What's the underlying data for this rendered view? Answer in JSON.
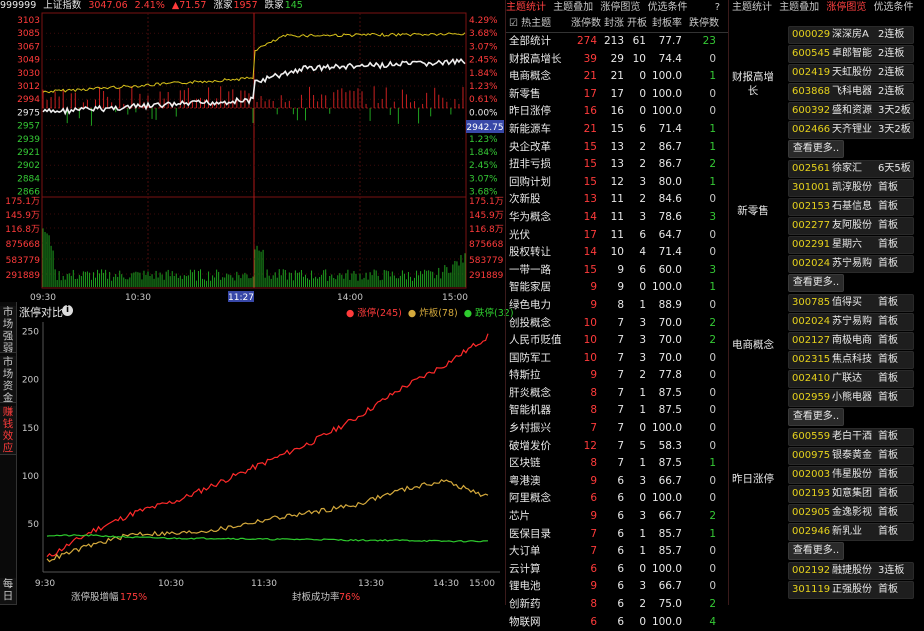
{
  "index_header": {
    "code": "999999",
    "name": "上证指数",
    "price": "3047.06",
    "pct": "2.41%",
    "change": "▲71.57",
    "up_label": "涨家",
    "up_count": "1957",
    "down_label": "跌家",
    "down_count": "145"
  },
  "main_chart": {
    "left_price_ticks": [
      "3103",
      "3085",
      "3067",
      "3049",
      "3030",
      "3012",
      "2994",
      "2975",
      "2957",
      "2939",
      "2921",
      "2902",
      "2884",
      "2866"
    ],
    "right_pct_ticks": [
      "4.29%",
      "3.68%",
      "3.07%",
      "2.45%",
      "1.84%",
      "1.23%",
      "0.61%",
      "0.00%",
      "0.61%",
      "1.23%",
      "1.84%",
      "2.45%",
      "3.07%",
      "3.68%"
    ],
    "left_vol_ticks": [
      "175.1万",
      "145.9万",
      "116.8万",
      "875668",
      "583779",
      "291889"
    ],
    "right_vol_ticks": [
      "175.1万",
      "145.9万",
      "116.8万",
      "875668",
      "583779",
      "291889"
    ],
    "time_ticks": [
      "09:30",
      "10:30",
      "14:00",
      "15:00"
    ],
    "cursor_time": "11:27",
    "cursor_price": "2942.75"
  },
  "limit_chart": {
    "title": "涨停对比",
    "info_icon": "i",
    "legend_up": "● 涨停(245)",
    "legend_broken": "● 炸板(78)",
    "legend_down": "● 跌停(32)",
    "side_tabs": [
      "市场强弱",
      "市场资金",
      "赚钱效应",
      "每日"
    ],
    "y_ticks": [
      "250",
      "200",
      "150",
      "100",
      "50"
    ],
    "x_ticks": [
      "9:30",
      "10:30",
      "11:30",
      "13:30",
      "14:30",
      "15:00"
    ],
    "footer_left_label": "涨停股增幅",
    "footer_left_value": "175%",
    "footer_right_label": "封板成功率",
    "footer_right_value": "76%"
  },
  "chart_data": {
    "type": "line",
    "title": "涨停对比",
    "x": [
      "9:30",
      "10:30",
      "11:30",
      "13:30",
      "14:30",
      "15:00"
    ],
    "ylim": [
      0,
      260
    ],
    "series": [
      {
        "name": "涨停",
        "color": "#ff2a2a",
        "values": [
          15,
          42,
          62,
          75,
          95,
          115,
          135,
          160,
          190,
          215,
          245
        ]
      },
      {
        "name": "炸板",
        "color": "#d4a93c",
        "values": [
          12,
          28,
          40,
          40,
          45,
          55,
          62,
          70,
          85,
          95,
          78
        ]
      },
      {
        "name": "跌停",
        "color": "#2ecc2e",
        "values": [
          38,
          38,
          36,
          35,
          35,
          34,
          34,
          33,
          33,
          32,
          32
        ]
      }
    ]
  },
  "theme_panel": {
    "tabs": [
      "主题统计",
      "主题叠加",
      "涨停图览",
      "优选条件"
    ],
    "help": "?",
    "columns": [
      "热主题",
      "涨停数",
      "封涨",
      "开板",
      "封板率",
      "跌停数"
    ],
    "subheader_left": "☑ 热主题",
    "rows": [
      {
        "name": "全部统计",
        "a": "274",
        "b": "213",
        "c": "61",
        "d": "77.7",
        "e": "23"
      },
      {
        "name": "财报高增长",
        "a": "39",
        "b": "29",
        "c": "10",
        "d": "74.4",
        "e": "0"
      },
      {
        "name": "电商概念",
        "a": "21",
        "b": "21",
        "c": "0",
        "d": "100.0",
        "e": "1"
      },
      {
        "name": "新零售",
        "a": "17",
        "b": "17",
        "c": "0",
        "d": "100.0",
        "e": "0"
      },
      {
        "name": "昨日涨停",
        "a": "16",
        "b": "16",
        "c": "0",
        "d": "100.0",
        "e": "0"
      },
      {
        "name": "新能源车",
        "a": "21",
        "b": "15",
        "c": "6",
        "d": "71.4",
        "e": "1"
      },
      {
        "name": "央企改革",
        "a": "15",
        "b": "13",
        "c": "2",
        "d": "86.7",
        "e": "1"
      },
      {
        "name": "扭非亏损",
        "a": "15",
        "b": "13",
        "c": "2",
        "d": "86.7",
        "e": "2"
      },
      {
        "name": "回购计划",
        "a": "15",
        "b": "12",
        "c": "3",
        "d": "80.0",
        "e": "1"
      },
      {
        "name": "次新股",
        "a": "13",
        "b": "11",
        "c": "2",
        "d": "84.6",
        "e": "0"
      },
      {
        "name": "华为概念",
        "a": "14",
        "b": "11",
        "c": "3",
        "d": "78.6",
        "e": "3"
      },
      {
        "name": "光伏",
        "a": "17",
        "b": "11",
        "c": "6",
        "d": "64.7",
        "e": "0"
      },
      {
        "name": "股权转让",
        "a": "14",
        "b": "10",
        "c": "4",
        "d": "71.4",
        "e": "0"
      },
      {
        "name": "一带一路",
        "a": "15",
        "b": "9",
        "c": "6",
        "d": "60.0",
        "e": "3"
      },
      {
        "name": "智能家居",
        "a": "9",
        "b": "9",
        "c": "0",
        "d": "100.0",
        "e": "1"
      },
      {
        "name": "绿色电力",
        "a": "9",
        "b": "8",
        "c": "1",
        "d": "88.9",
        "e": "0"
      },
      {
        "name": "创投概念",
        "a": "10",
        "b": "7",
        "c": "3",
        "d": "70.0",
        "e": "2"
      },
      {
        "name": "人民币贬值",
        "a": "10",
        "b": "7",
        "c": "3",
        "d": "70.0",
        "e": "2"
      },
      {
        "name": "国防军工",
        "a": "10",
        "b": "7",
        "c": "3",
        "d": "70.0",
        "e": "0"
      },
      {
        "name": "特斯拉",
        "a": "9",
        "b": "7",
        "c": "2",
        "d": "77.8",
        "e": "0"
      },
      {
        "name": "肝炎概念",
        "a": "8",
        "b": "7",
        "c": "1",
        "d": "87.5",
        "e": "0"
      },
      {
        "name": "智能机器",
        "a": "8",
        "b": "7",
        "c": "1",
        "d": "87.5",
        "e": "0"
      },
      {
        "name": "乡村振兴",
        "a": "7",
        "b": "7",
        "c": "0",
        "d": "100.0",
        "e": "0"
      },
      {
        "name": "破增发价",
        "a": "12",
        "b": "7",
        "c": "5",
        "d": "58.3",
        "e": "0"
      },
      {
        "name": "区块链",
        "a": "8",
        "b": "7",
        "c": "1",
        "d": "87.5",
        "e": "1"
      },
      {
        "name": "粤港澳",
        "a": "9",
        "b": "6",
        "c": "3",
        "d": "66.7",
        "e": "0"
      },
      {
        "name": "阿里概念",
        "a": "6",
        "b": "6",
        "c": "0",
        "d": "100.0",
        "e": "0"
      },
      {
        "name": "芯片",
        "a": "9",
        "b": "6",
        "c": "3",
        "d": "66.7",
        "e": "2"
      },
      {
        "name": "医保目录",
        "a": "7",
        "b": "6",
        "c": "1",
        "d": "85.7",
        "e": "1"
      },
      {
        "name": "大订单",
        "a": "7",
        "b": "6",
        "c": "1",
        "d": "85.7",
        "e": "0"
      },
      {
        "name": "云计算",
        "a": "6",
        "b": "6",
        "c": "0",
        "d": "100.0",
        "e": "0"
      },
      {
        "name": "锂电池",
        "a": "9",
        "b": "6",
        "c": "3",
        "d": "66.7",
        "e": "0"
      },
      {
        "name": "创新药",
        "a": "8",
        "b": "6",
        "c": "2",
        "d": "75.0",
        "e": "2"
      },
      {
        "name": "物联网",
        "a": "6",
        "b": "6",
        "c": "0",
        "d": "100.0",
        "e": "4"
      }
    ]
  },
  "limit_panel": {
    "tabs": [
      "主题统计",
      "主题叠加",
      "涨停图览",
      "优选条件"
    ],
    "more_label": "查看更多..",
    "groups": [
      {
        "label": "财报高增长",
        "stocks": [
          {
            "code": "000029",
            "name": "深深房A",
            "status": "2连板"
          },
          {
            "code": "600545",
            "name": "卓郎智能",
            "status": "2连板"
          },
          {
            "code": "002419",
            "name": "天虹股份",
            "status": "2连板"
          },
          {
            "code": "603868",
            "name": "飞科电器",
            "status": "2连板"
          },
          {
            "code": "600392",
            "name": "盛和资源",
            "status": "3天2板"
          },
          {
            "code": "002466",
            "name": "天齐锂业",
            "status": "3天2板"
          }
        ]
      },
      {
        "label": "新零售",
        "stocks": [
          {
            "code": "002561",
            "name": "徐家汇",
            "status": "6天5板"
          },
          {
            "code": "301001",
            "name": "凯淳股份",
            "status": "首板"
          },
          {
            "code": "002153",
            "name": "石基信息",
            "status": "首板"
          },
          {
            "code": "002277",
            "name": "友阿股份",
            "status": "首板"
          },
          {
            "code": "002291",
            "name": "星期六",
            "status": "首板"
          },
          {
            "code": "002024",
            "name": "苏宁易购",
            "status": "首板"
          }
        ]
      },
      {
        "label": "电商概念",
        "stocks": [
          {
            "code": "300785",
            "name": "值得买",
            "status": "首板"
          },
          {
            "code": "002024",
            "name": "苏宁易购",
            "status": "首板"
          },
          {
            "code": "002127",
            "name": "南极电商",
            "status": "首板"
          },
          {
            "code": "002315",
            "name": "焦点科技",
            "status": "首板"
          },
          {
            "code": "002410",
            "name": "广联达",
            "status": "首板"
          },
          {
            "code": "002959",
            "name": "小熊电器",
            "status": "首板"
          }
        ]
      },
      {
        "label": "昨日涨停",
        "stocks": [
          {
            "code": "600559",
            "name": "老白干酒",
            "status": "首板"
          },
          {
            "code": "000975",
            "name": "银泰黄金",
            "status": "首板"
          },
          {
            "code": "002003",
            "name": "伟星股份",
            "status": "首板"
          },
          {
            "code": "002193",
            "name": "如意集团",
            "status": "首板"
          },
          {
            "code": "002905",
            "name": "金逸影视",
            "status": "首板"
          },
          {
            "code": "002946",
            "name": "新乳业",
            "status": "首板"
          }
        ]
      },
      {
        "label": "",
        "stocks": [
          {
            "code": "002192",
            "name": "融捷股份",
            "status": "3连板"
          },
          {
            "code": "301119",
            "name": "正强股份",
            "status": "首板"
          }
        ]
      }
    ]
  }
}
